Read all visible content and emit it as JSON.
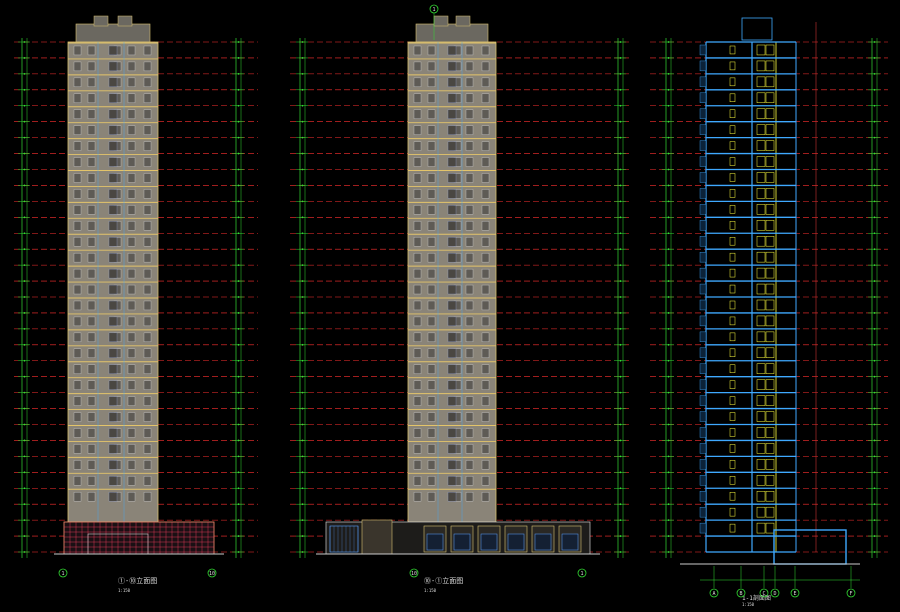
{
  "canvas": {
    "background": "#000000"
  },
  "colors": {
    "floor_line": "#ff3030",
    "dim_line": "#33dd33",
    "facade_fill": "#8a8478",
    "facade_edge": "#d8c070",
    "window": "#c8c8c8",
    "section_wall": "#3fa9ff",
    "section_line": "#ffff40",
    "label": "#dddddd",
    "podium_grid": "#ff4060",
    "axis_bubble": "#33dd33"
  },
  "drawings": [
    {
      "id": "elevation-1",
      "kind": "elevation",
      "floors": 32,
      "podium": "glass-grid",
      "title": "①-⑩立面图",
      "scale": "1:150",
      "axis_left": "1",
      "axis_right": "10"
    },
    {
      "id": "elevation-2",
      "kind": "elevation",
      "floors": 32,
      "podium": "shopfront",
      "title": "⑩-①立面图",
      "scale": "1:150",
      "axis_left": "10",
      "axis_right": "1",
      "axis_top": "1"
    },
    {
      "id": "section-1",
      "kind": "section",
      "floors": 32,
      "title": "1-1剖面图",
      "scale": "1:150",
      "axes": [
        "A",
        "B",
        "C",
        "D",
        "E",
        "F"
      ]
    }
  ]
}
